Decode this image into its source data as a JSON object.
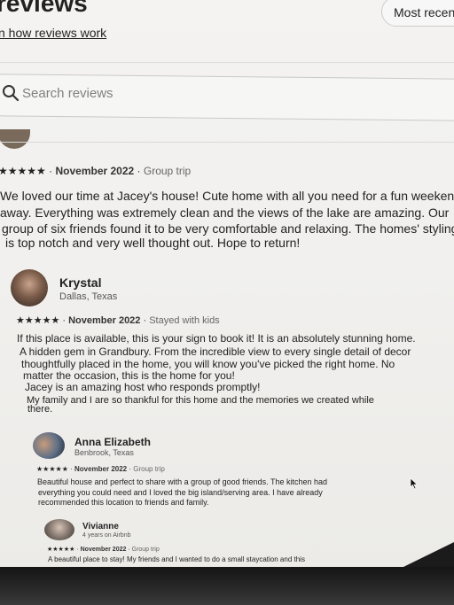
{
  "header": {
    "title": "reviews",
    "learn_link": "n how reviews work",
    "sort_label": "Most recent"
  },
  "search": {
    "placeholder": "Search reviews"
  },
  "reviews": [
    {
      "stars": "★★★★★",
      "date": "November 2022",
      "trip": "Group trip",
      "lines": [
        "We loved our time at Jacey's house! Cute home with all you need for a fun weekend",
        "away. Everything was extremely clean and the views of the lake are amazing. Our",
        "group of six friends found it to be very comfortable and relaxing. The homes' styling",
        "is top notch and very well thought out. Hope to return!"
      ]
    },
    {
      "name": "Krystal",
      "location": "Dallas, Texas",
      "stars": "★★★★★",
      "date": "November 2022",
      "trip": "Stayed with kids",
      "lines": [
        "If this place is available, this is your sign to book it! It is an absolutely stunning home.",
        "A hidden gem in Grandbury. From the incredible view to every single detail of decor",
        "thoughtfully placed in the home, you will know you've picked the right home. No",
        "matter the occasion, this is the home for you!",
        "Jacey is an amazing host who responds promptly!",
        "My family and I are so thankful for this home and the memories we created while",
        "there."
      ]
    },
    {
      "name": "Anna Elizabeth",
      "location": "Benbrook, Texas",
      "stars": "★★★★★",
      "date": "November 2022",
      "trip": "Group trip",
      "lines": [
        "Beautiful house and perfect to share with a group of good friends. The kitchen had",
        "everything you could need and I loved the big island/serving area. I have already",
        "recommended this location to friends and family."
      ]
    },
    {
      "name": "Vivianne",
      "location": "4 years on Airbnb",
      "stars": "★★★★★",
      "date": "November 2022",
      "trip": "Group trip",
      "lines": [
        "A beautiful place to stay! My friends and I wanted to do a small staycation and this"
      ]
    }
  ]
}
